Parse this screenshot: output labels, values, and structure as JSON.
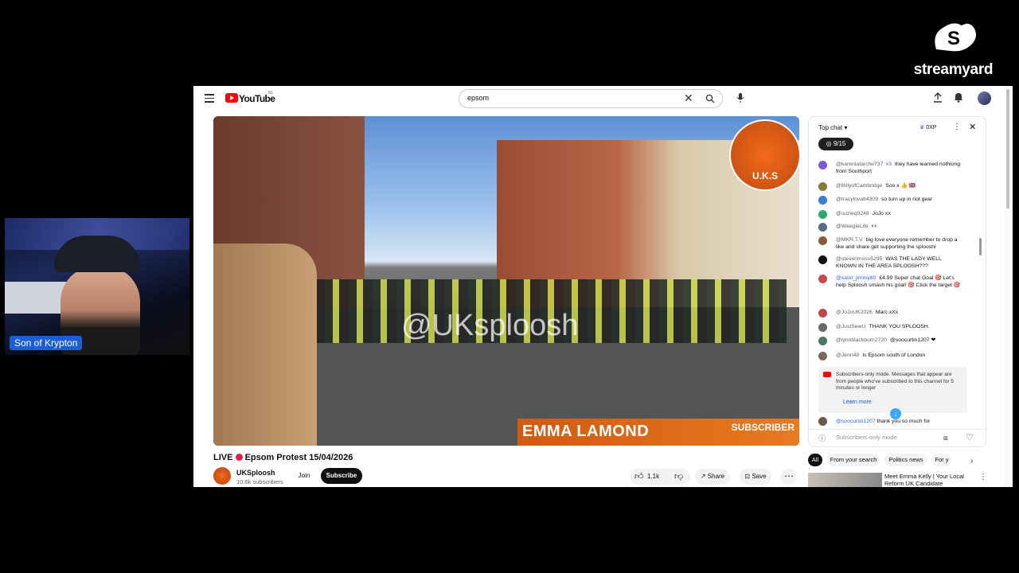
{
  "streamyard": {
    "wordmark": "streamyard"
  },
  "webcam": {
    "name": "Son of Krypton"
  },
  "youtube": {
    "logo": "YouTube",
    "region": "NL",
    "search": {
      "value": "epsom"
    },
    "video": {
      "watermark": "@UKsploosh",
      "lower_third_name": "EMMA LAMOND",
      "lower_third_tag": "SUBSCRIBER",
      "logo_text": "U.K.S"
    },
    "title_live": "LIVE",
    "title": "Epsom Protest 15/04/2026",
    "channel": {
      "name": "UKSploosh",
      "subscribers": "10.6k subscribers",
      "join": "Join",
      "subscribe": "Subscribe"
    },
    "actions": {
      "likes": "1.1k",
      "share": "Share",
      "save": "Save"
    },
    "chips": [
      "All",
      "From your search",
      "Politics news",
      "For y"
    ],
    "rec": {
      "title": "Meet Emma Kelly | Your Local Reform UK Candidate"
    }
  },
  "chat": {
    "header": "Top chat",
    "points": "0XP",
    "goal": "9/15",
    "messages": [
      {
        "user": "@karenlatarche737",
        "text": "they have learned nothiong from Southport",
        "color": "#7b5cd6",
        "badge": "#3"
      },
      {
        "user": "@BillyofCambridge",
        "text": "Soo x 👍 🇬🇧",
        "color": "#8a7a3a"
      },
      {
        "user": "@tracylovatt4309",
        "text": "so turn up in riot gear",
        "color": "#3a7bd5"
      },
      {
        "user": "@suzieq9248",
        "text": "JoJo xx",
        "color": "#2aa86a"
      },
      {
        "user": "@WeegieLife",
        "text": "👀",
        "color": "#5a6a8a"
      },
      {
        "user": "@MKR.T.V",
        "text": "big love everyone remember to drop a like and share get supporting the splooshi",
        "color": "#8a5a3a"
      },
      {
        "user": "@stevenmoss5295",
        "text": "WAS THE LADY WELL KNOWN IN THE AREA SPLOOSH???",
        "color": "#111111"
      },
      {
        "user": "@saint_jimmy80",
        "text": "£4.99 Super chat Goal 🎯 Let's help Sploosh smash his goal! 🎯 Click the target 🎯",
        "color": "#c84a4a"
      },
      {
        "user": "@JoJoUK2026",
        "text": "Marc xXx",
        "color": "#b84a4a"
      },
      {
        "user": "@JustSewU",
        "text": "THANK YOU SPLOOSH",
        "color": "#6a6a6a"
      },
      {
        "user": "@lynnblackburn2720",
        "text": "@soocurtin1207 ❤",
        "color": "#4a7a5a"
      },
      {
        "user": "@Jenn48",
        "text": "Is Epsom south of London",
        "color": "#7a6a5a"
      }
    ],
    "notice": {
      "text": "Subscribers-only mode. Messages that appear are from people who've subscribed to this channel for 5 minutes or longer",
      "link": "Learn more"
    },
    "partial_user": "@soocurtin1207",
    "partial_text": "thank you so much for",
    "input_placeholder": "Subscribers-only mode"
  }
}
